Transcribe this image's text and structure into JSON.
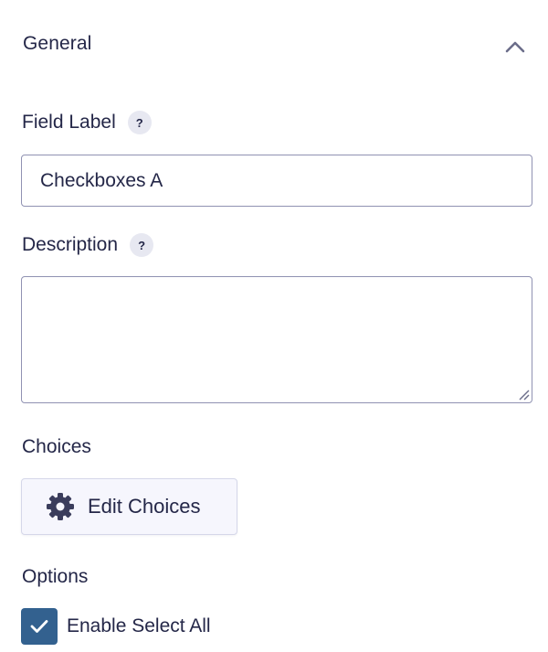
{
  "section": {
    "title": "General"
  },
  "field_label": {
    "label": "Field Label",
    "help": "?",
    "value": "Checkboxes A"
  },
  "description": {
    "label": "Description",
    "help": "?",
    "value": ""
  },
  "choices": {
    "label": "Choices",
    "edit_button_label": "Edit Choices"
  },
  "options": {
    "label": "Options",
    "enable_select_all": {
      "label": "Enable Select All",
      "checked": true
    }
  },
  "colors": {
    "text": "#242748",
    "border": "#9092b2",
    "checkbox_fill": "#33618f",
    "help_badge_bg": "#e7e8f1",
    "button_bg": "#f6f6fd"
  },
  "icons": {
    "collapse": "chevron-up-icon",
    "help": "question-icon",
    "settings": "gear-icon",
    "check": "check-icon"
  }
}
